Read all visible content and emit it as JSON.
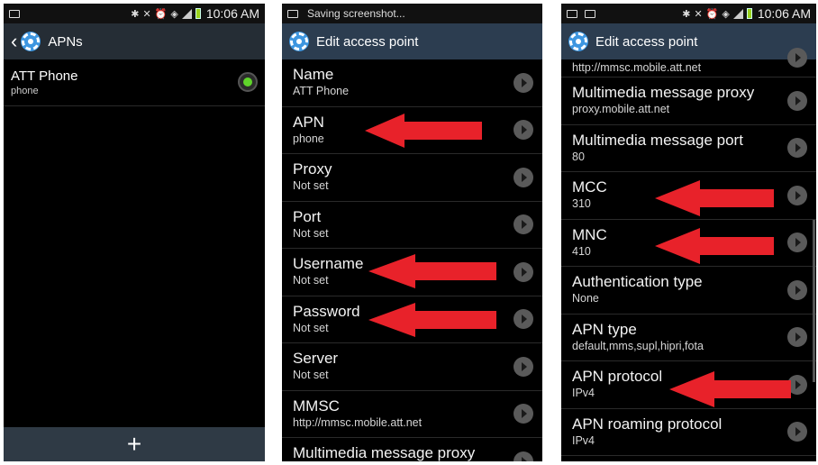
{
  "colors": {
    "accent_red": "#e8222a",
    "radio_green": "#5fd42a",
    "gear_blue": "#3d96e0"
  },
  "screen1": {
    "status_time": "10:06 AM",
    "title": "APNs",
    "apns": [
      {
        "name": "ATT Phone",
        "apn": "phone",
        "selected": true
      }
    ],
    "add_label": "+"
  },
  "screen2": {
    "status_text": "Saving screenshot...",
    "title": "Edit access point",
    "fields": [
      {
        "label": "Name",
        "value": "ATT Phone"
      },
      {
        "label": "APN",
        "value": "phone"
      },
      {
        "label": "Proxy",
        "value": "Not set"
      },
      {
        "label": "Port",
        "value": "Not set"
      },
      {
        "label": "Username",
        "value": "Not set"
      },
      {
        "label": "Password",
        "value": "Not set"
      },
      {
        "label": "Server",
        "value": "Not set"
      },
      {
        "label": "MMSC",
        "value": "http://mmsc.mobile.att.net"
      },
      {
        "label": "Multimedia message proxy",
        "value": ""
      }
    ]
  },
  "screen3": {
    "status_time": "10:06 AM",
    "title": "Edit access point",
    "top_value": "http://mmsc.mobile.att.net",
    "fields": [
      {
        "label": "Multimedia message proxy",
        "value": "proxy.mobile.att.net"
      },
      {
        "label": "Multimedia message port",
        "value": "80"
      },
      {
        "label": "MCC",
        "value": "310"
      },
      {
        "label": "MNC",
        "value": "410"
      },
      {
        "label": "Authentication type",
        "value": "None"
      },
      {
        "label": "APN type",
        "value": "default,mms,supl,hipri,fota"
      },
      {
        "label": "APN protocol",
        "value": "IPv4"
      },
      {
        "label": "APN roaming protocol",
        "value": "IPv4"
      }
    ]
  }
}
